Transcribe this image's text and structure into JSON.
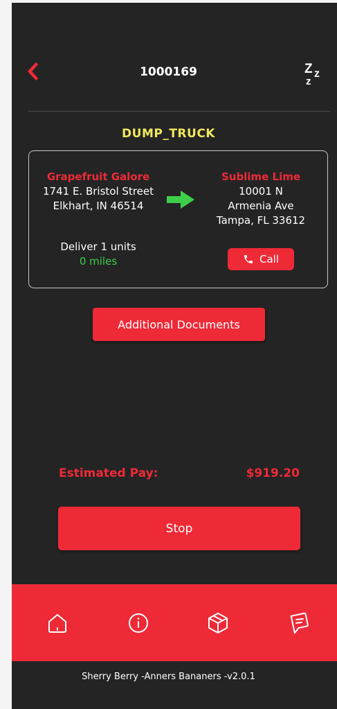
{
  "header": {
    "title": "1000169",
    "back_icon": "chevron-left-icon",
    "sleep_icon": "zzz-icon"
  },
  "vehicle_type": "DUMP_TRUCK",
  "route": {
    "origin": {
      "name": "Grapefruit Galore",
      "address_line1": "1741 E. Bristol Street",
      "address_line2": "Elkhart, IN 46514"
    },
    "destination": {
      "name": "Sublime Lime",
      "address_line1": "10001 N",
      "address_line2": "Armenia Ave",
      "address_line3": "Tampa, FL 33612"
    },
    "deliver_text": "Deliver 1 units",
    "distance": "0 miles",
    "call_label": "Call"
  },
  "additional_documents_label": "Additional Documents",
  "pay": {
    "label": "Estimated Pay:",
    "value": "$919.20"
  },
  "stop_label": "Stop",
  "nav": {
    "items": [
      {
        "icon": "home-icon"
      },
      {
        "icon": "info-icon"
      },
      {
        "icon": "package-icon"
      },
      {
        "icon": "chat-icon"
      }
    ]
  },
  "footer": {
    "text": "Sherry Berry  -Anners Bananers  -v2.0.1"
  },
  "colors": {
    "accent": "#ee2a37",
    "background": "#242424",
    "vehicle": "#f2e85e",
    "distance": "#3ecf4a",
    "arrow": "#3ecf4a"
  }
}
